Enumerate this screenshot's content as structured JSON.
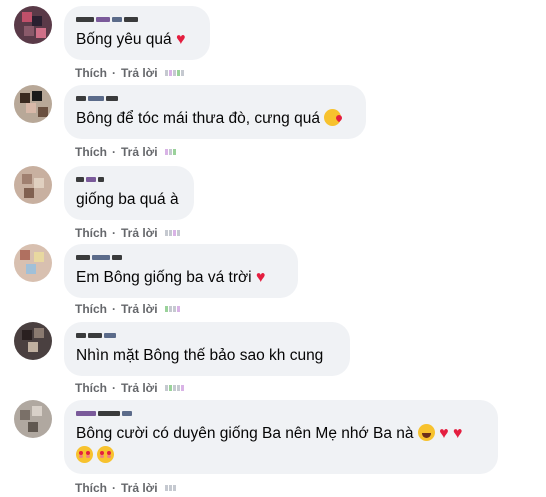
{
  "comments": [
    {
      "text": "Bống yêu quá",
      "like_label": "Thích",
      "reply_label": "Trả lời",
      "reaction": "red-heart"
    },
    {
      "text": "Bông để tóc mái thưa đò, cưng quá",
      "like_label": "Thích",
      "reply_label": "Trả lời",
      "reaction": "kiss-emoji"
    },
    {
      "text": "giống ba quá à",
      "like_label": "Thích",
      "reply_label": "Trả lời",
      "reaction": ""
    },
    {
      "text": "Em Bông giống ba vá trời",
      "like_label": "Thích",
      "reply_label": "Trả lời",
      "reaction": "red-heart"
    },
    {
      "text": "Nhìn mặt Bông thế bảo sao kh cung",
      "like_label": "Thích",
      "reply_label": "Trả lời",
      "reaction": ""
    },
    {
      "text": "Bông cười có duyên giống Ba nên Mẹ nhớ Ba nà",
      "like_label": "Thích",
      "reply_label": "Trả lời",
      "reaction": "laugh-emoji red-heart red-heart smiling-hearts-emoji smiling-hearts-emoji"
    }
  ],
  "heart_glyph": "♥",
  "colors": {
    "bubble": "#f0f2f5",
    "heart": "#e41e3f",
    "action_text": "#65676b"
  }
}
